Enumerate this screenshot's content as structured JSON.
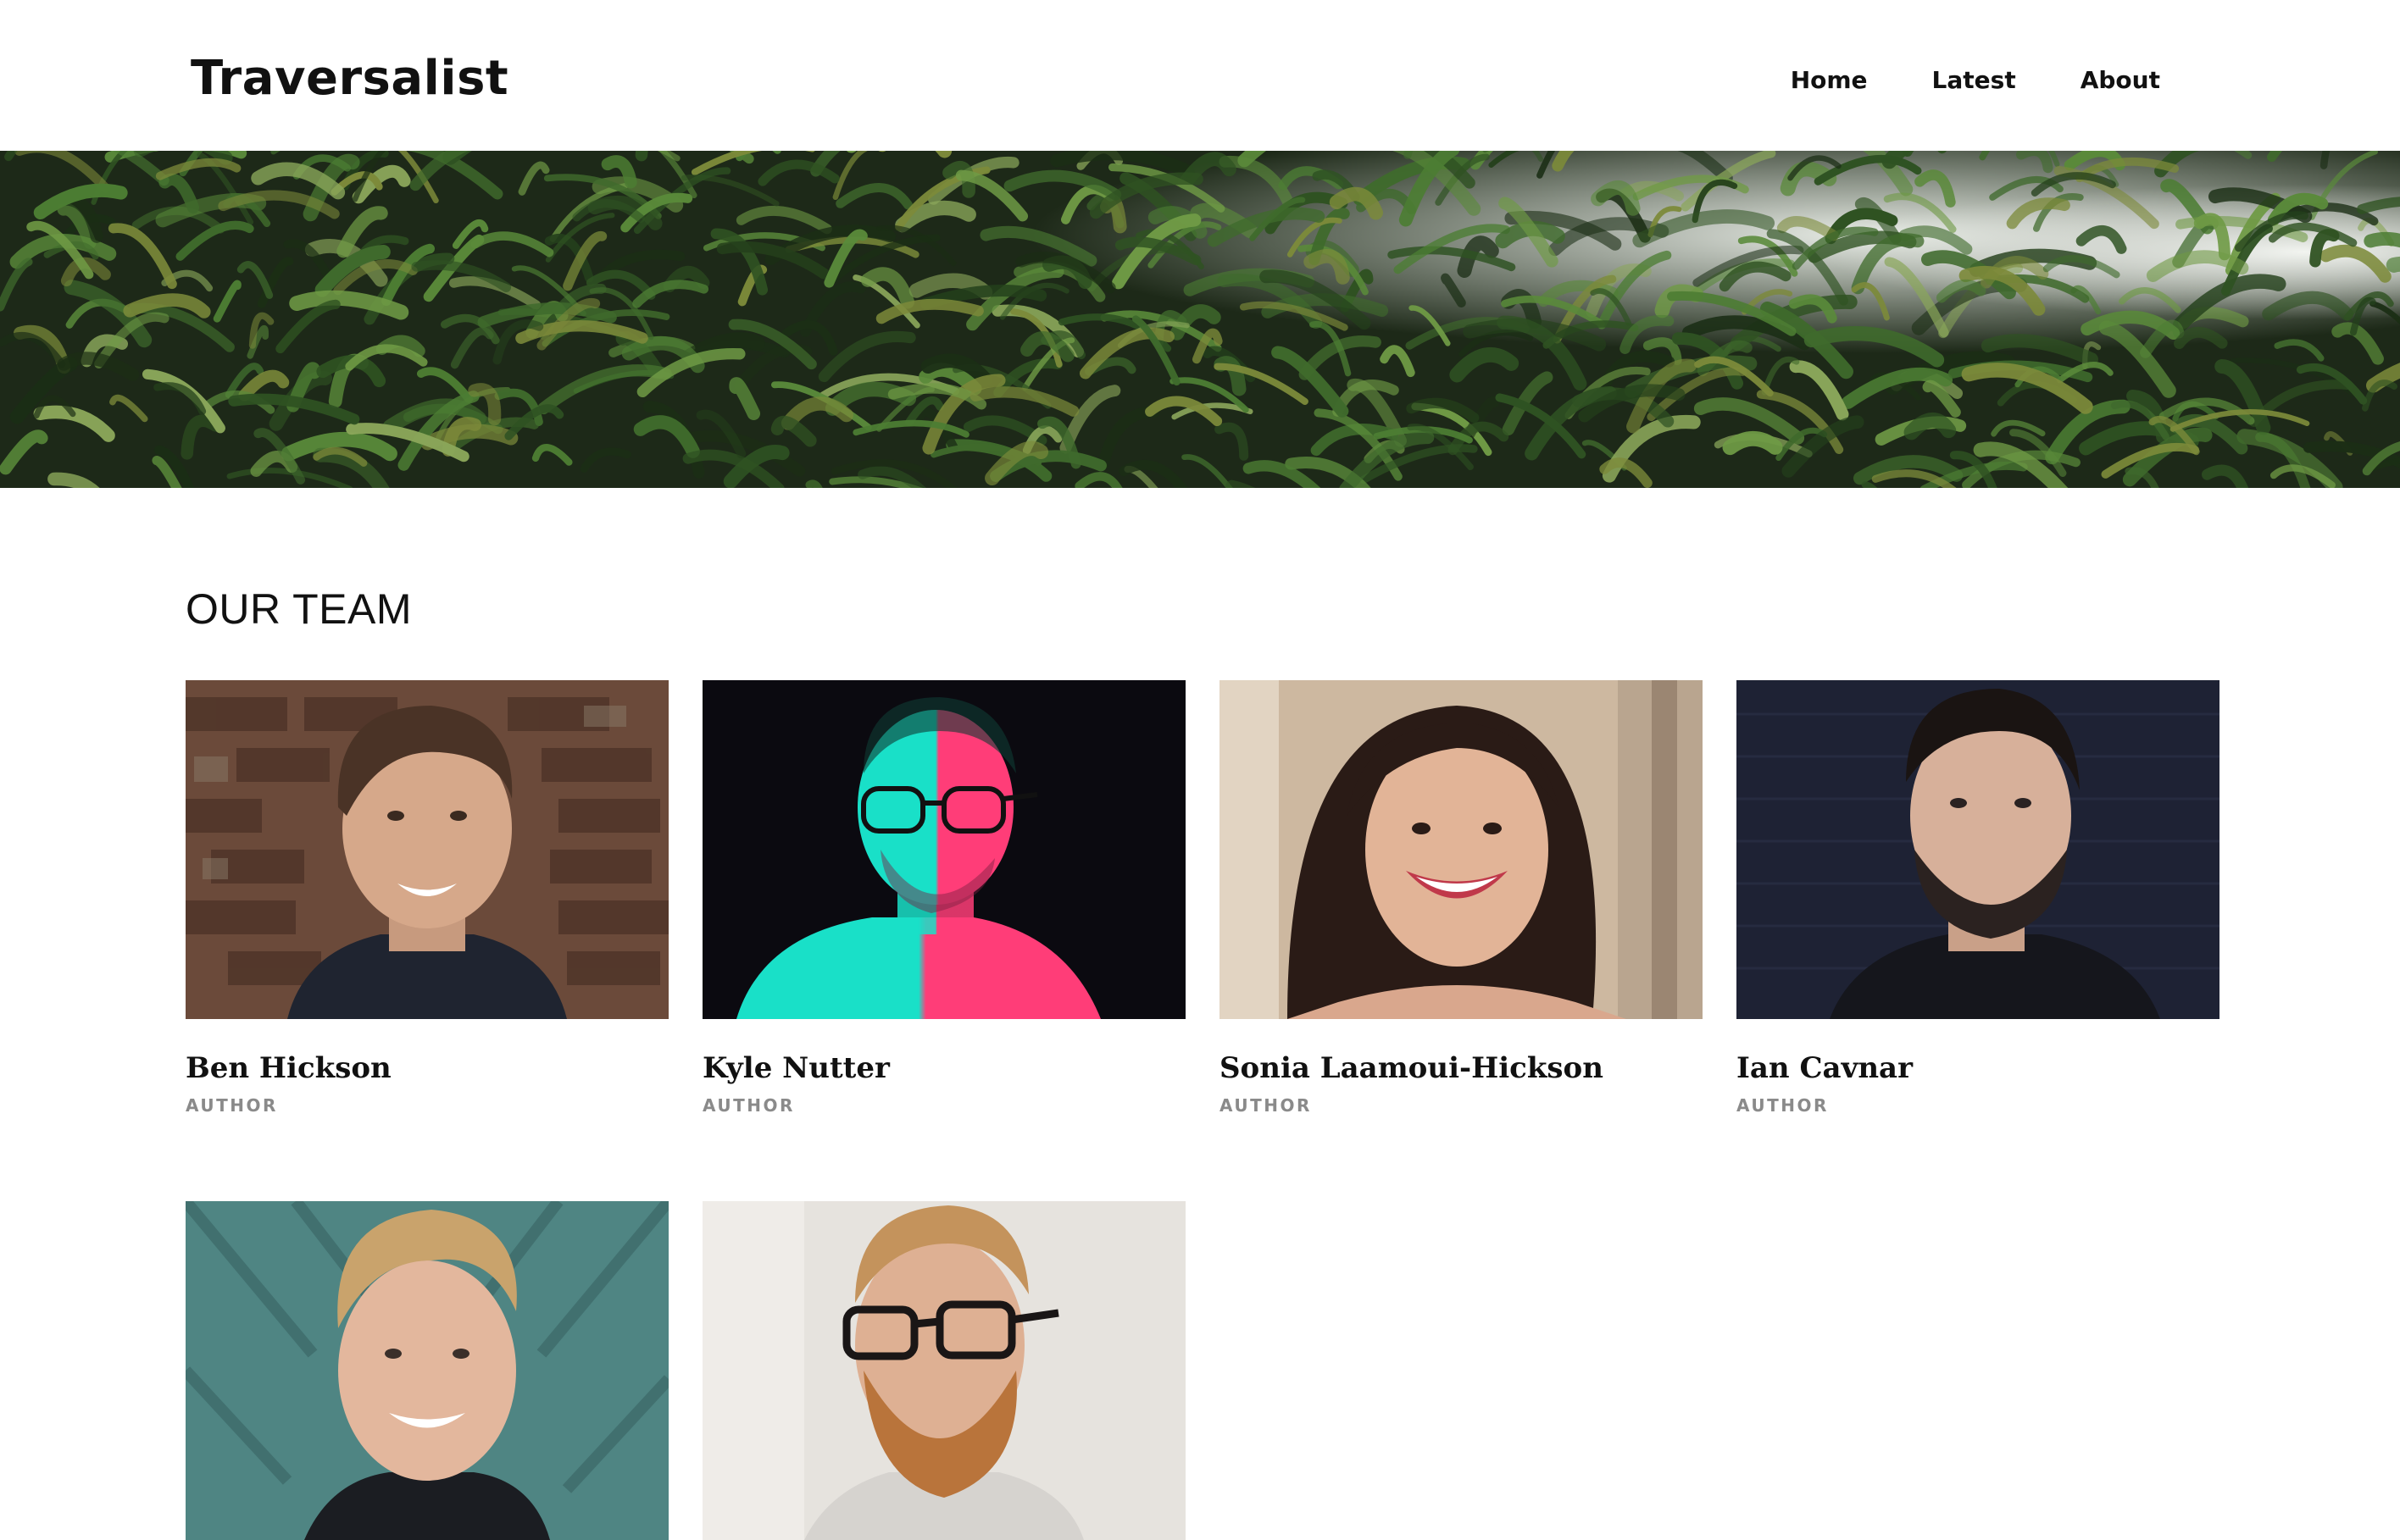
{
  "site": {
    "brand": "Traversalist",
    "nav": [
      {
        "label": "Home"
      },
      {
        "label": "Latest"
      },
      {
        "label": "About"
      }
    ]
  },
  "hero": {
    "image": "jungle-foliage-banner"
  },
  "team": {
    "title": "OUR TEAM",
    "members": [
      {
        "name": "Ben Hickson",
        "role": "AUTHOR",
        "photo": "portrait-brick-wall"
      },
      {
        "name": "Kyle Nutter",
        "role": "AUTHOR",
        "photo": "portrait-neon-glasses"
      },
      {
        "name": "Sonia Laamoui-Hickson",
        "role": "AUTHOR",
        "photo": "portrait-stone-pillar"
      },
      {
        "name": "Ian Cavnar",
        "role": "AUTHOR",
        "photo": "portrait-navy-brick"
      },
      {
        "name": "",
        "role": "",
        "photo": "portrait-teal-door"
      },
      {
        "name": "",
        "role": "",
        "photo": "portrait-bearded-glasses"
      }
    ]
  },
  "colors": {
    "text": "#111111",
    "muted": "#8a8a8a",
    "background": "#ffffff",
    "foliage": "#2f4a22"
  }
}
